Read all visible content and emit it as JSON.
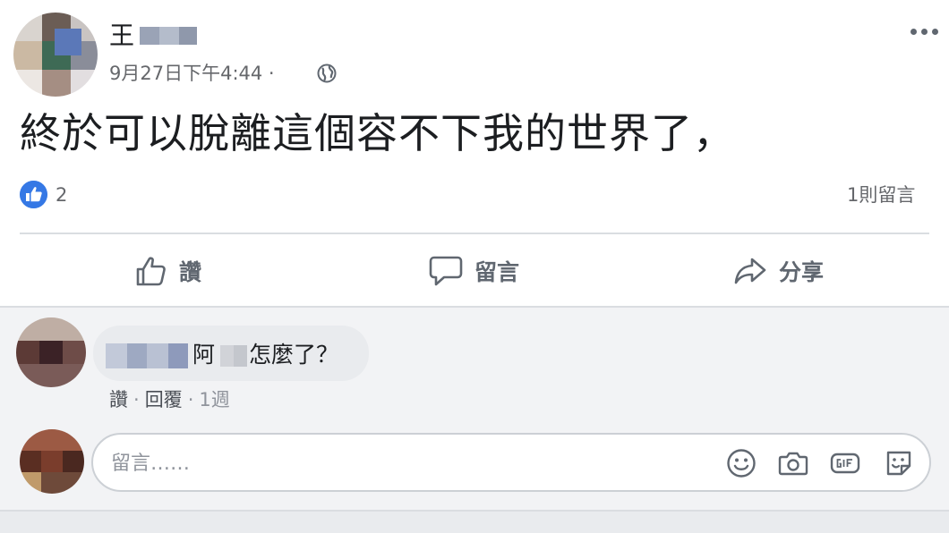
{
  "post": {
    "author_name": "王",
    "timestamp": "9月27日下午4:44 ·",
    "text": "終於可以脫離這個容不下我的世界了，"
  },
  "reactions": {
    "like_count": "2",
    "comment_count": "1則留言"
  },
  "actions": {
    "like_label": "讚",
    "comment_label": "留言",
    "share_label": "分享"
  },
  "comment": {
    "lead_text": "阿",
    "tail_text": "怎麼了？",
    "like_link": "讚",
    "separator": "·",
    "reply_link": "回覆",
    "age": "1週"
  },
  "composer": {
    "placeholder": "留言……"
  },
  "icons": {
    "more": "more-dots-icon",
    "privacy": "globe-icon",
    "reaction": "like-reaction-icon",
    "like": "thumbs-up-icon",
    "comment": "speech-bubble-icon",
    "share": "share-arrow-icon",
    "emoji": "emoji-icon",
    "camera": "camera-icon",
    "gif": "gif-icon",
    "sticker": "sticker-icon"
  },
  "colors": {
    "accent": "#3578e5",
    "text": "#1c1e21",
    "secondary": "#65676b",
    "action": "#606770",
    "bubble": "#e9ebee"
  }
}
